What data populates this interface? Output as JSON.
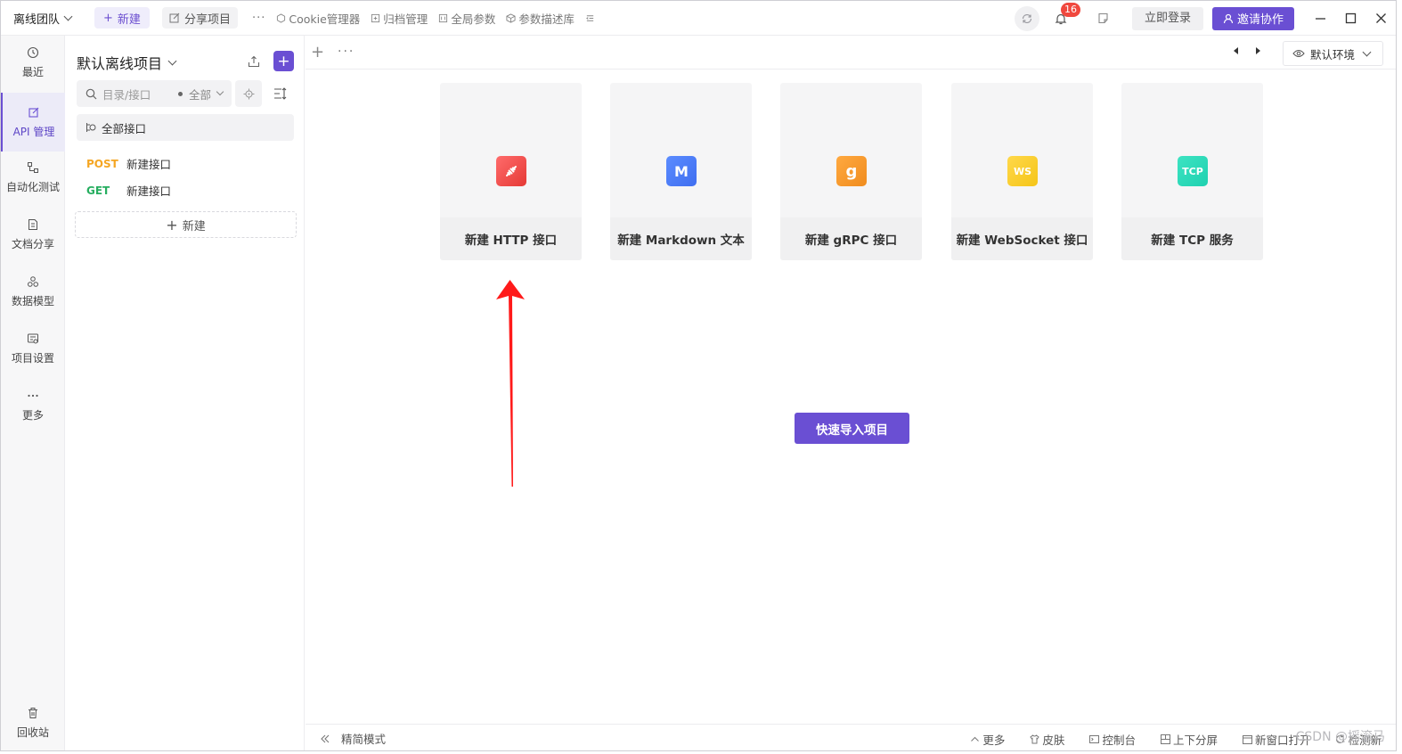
{
  "topbar": {
    "team_name": "离线团队",
    "new_label": "新建",
    "share_label": "分享项目",
    "more_dots": "···",
    "tools": [
      {
        "icon": "cookie-icon",
        "label": "Cookie管理器"
      },
      {
        "icon": "archive-icon",
        "label": "归档管理"
      },
      {
        "icon": "params-icon",
        "label": "全局参数"
      },
      {
        "icon": "cube-icon",
        "label": "参数描述库"
      }
    ],
    "notification_count": "16",
    "login_label": "立即登录",
    "invite_label": "邀请协作"
  },
  "rail": {
    "items": [
      {
        "icon": "clock-icon",
        "label": "最近"
      },
      {
        "icon": "edit-icon",
        "label": "API 管理"
      },
      {
        "icon": "flow-icon",
        "label": "自动化测试"
      },
      {
        "icon": "doc-icon",
        "label": "文档分享"
      },
      {
        "icon": "model-icon",
        "label": "数据模型"
      },
      {
        "icon": "settings-icon",
        "label": "项目设置"
      },
      {
        "icon": "dots-icon",
        "label": "更多"
      }
    ],
    "trash_label": "回收站"
  },
  "tree": {
    "project_name": "默认离线项目",
    "search_placeholder": "目录/接口",
    "filter_label": "全部",
    "all_apis_label": "全部接口",
    "apis": [
      {
        "method": "POST",
        "name": "新建接口",
        "color": "#f5a623"
      },
      {
        "method": "GET",
        "name": "新建接口",
        "color": "#27ae60"
      }
    ],
    "new_label": "新建"
  },
  "main": {
    "env_label": "默认环境",
    "cards": [
      {
        "label": "新建 HTTP 接口",
        "icon": "http-plug-icon",
        "color": "#ef5350"
      },
      {
        "label": "新建 Markdown 文本",
        "icon": "markdown-icon",
        "glyph": "M",
        "color": "#3f6ef0"
      },
      {
        "label": "新建 gRPC 接口",
        "icon": "grpc-icon",
        "glyph": "g",
        "color": "#f08c1e"
      },
      {
        "label": "新建 WebSocket 接口",
        "icon": "websocket-icon",
        "glyph": "WS",
        "color": "#f5c518"
      },
      {
        "label": "新建 TCP 服务",
        "icon": "tcp-icon",
        "glyph": "TCP",
        "color": "#1fd1b0"
      }
    ],
    "import_label": "快速导入项目"
  },
  "statusbar": {
    "compact_label": "精简模式",
    "items": [
      {
        "icon": "chevron-up-icon",
        "label": "更多"
      },
      {
        "icon": "shirt-icon",
        "label": "皮肤"
      },
      {
        "icon": "console-icon",
        "label": "控制台"
      },
      {
        "icon": "split-icon",
        "label": "上下分屏"
      },
      {
        "icon": "window-icon",
        "label": "新窗口打开"
      },
      {
        "icon": "refresh-icon",
        "label": "检测新"
      }
    ],
    "watermark": "CSDN @摇滚马"
  },
  "colors": {
    "accent": "#6a4fd3"
  }
}
